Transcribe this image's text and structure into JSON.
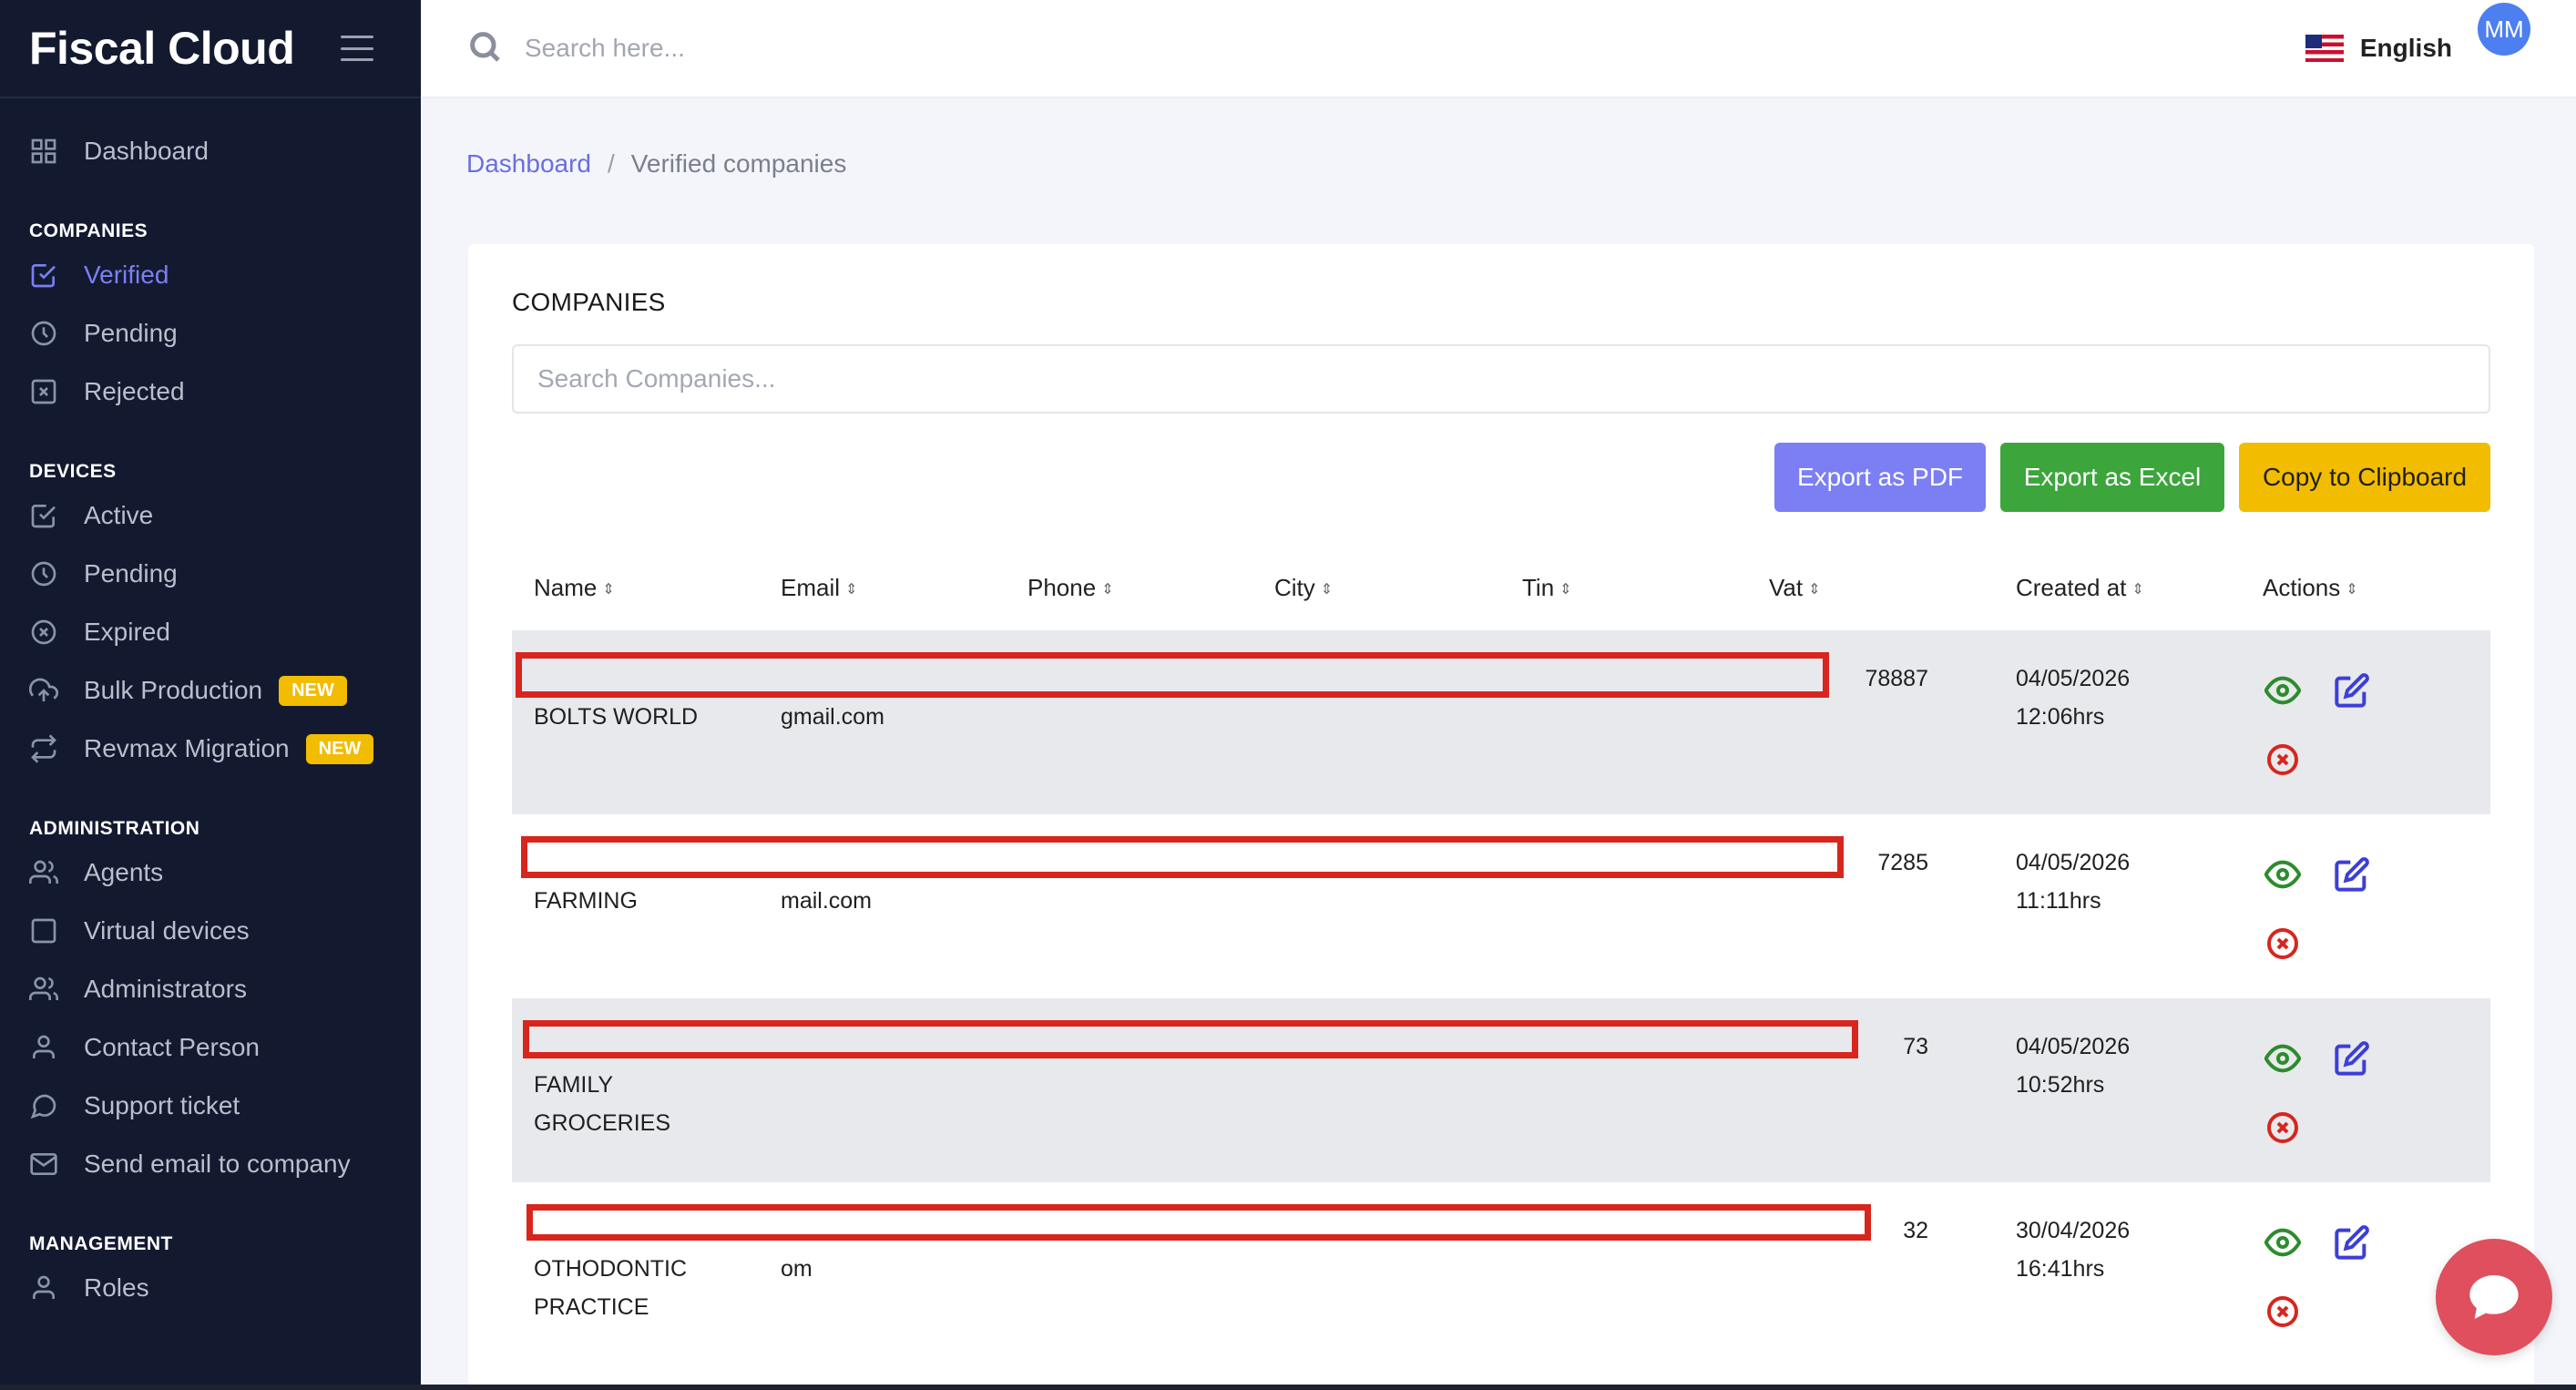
{
  "brand": "Fiscal Cloud",
  "topbar": {
    "search_placeholder": "Search here...",
    "language": "English",
    "avatar_initials": "MM"
  },
  "sidebar": {
    "dashboard": "Dashboard",
    "sections": {
      "companies": "COMPANIES",
      "devices": "DEVICES",
      "administration": "ADMINISTRATION",
      "management": "MANAGEMENT"
    },
    "companies": [
      "Verified",
      "Pending",
      "Rejected"
    ],
    "devices": [
      "Active",
      "Pending",
      "Expired",
      "Bulk Production",
      "Revmax Migration"
    ],
    "badge_new": "NEW",
    "administration": [
      "Agents",
      "Virtual devices",
      "Administrators",
      "Contact Person",
      "Support ticket",
      "Send email to company"
    ],
    "management": [
      "Roles"
    ]
  },
  "breadcrumb": {
    "home": "Dashboard",
    "separator": "/",
    "current": "Verified companies"
  },
  "card": {
    "title": "COMPANIES",
    "search_placeholder": "Search Companies...",
    "buttons": {
      "pdf": "Export as PDF",
      "excel": "Export as Excel",
      "clipboard": "Copy to Clipboard"
    }
  },
  "table": {
    "columns": [
      "Name",
      "Email",
      "Phone",
      "City",
      "Tin",
      "Vat",
      "Created at",
      "Actions"
    ],
    "rows": [
      {
        "name": [
          "BOLTS WORLD"
        ],
        "email": "gmail.com",
        "vat": "78887",
        "date": "04/05/2026",
        "time": "12:06hrs"
      },
      {
        "name": [
          "FARMING"
        ],
        "email": "mail.com",
        "vat": "7285",
        "date": "04/05/2026",
        "time": "11:11hrs"
      },
      {
        "name": [
          "FAMILY",
          "GROCERIES"
        ],
        "email": "",
        "vat": "73",
        "date": "04/05/2026",
        "time": "10:52hrs"
      },
      {
        "name": [
          "OTHODONTIC",
          "PRACTICE"
        ],
        "email": "om",
        "vat": "32",
        "date": "30/04/2026",
        "time": "16:41hrs"
      }
    ]
  },
  "colors": {
    "accent": "#7b7ff3",
    "sidebar_bg": "#131a30",
    "success": "#3ca53c",
    "warning": "#f2bc00",
    "danger": "#d7261e",
    "chat": "#df4f5d"
  }
}
